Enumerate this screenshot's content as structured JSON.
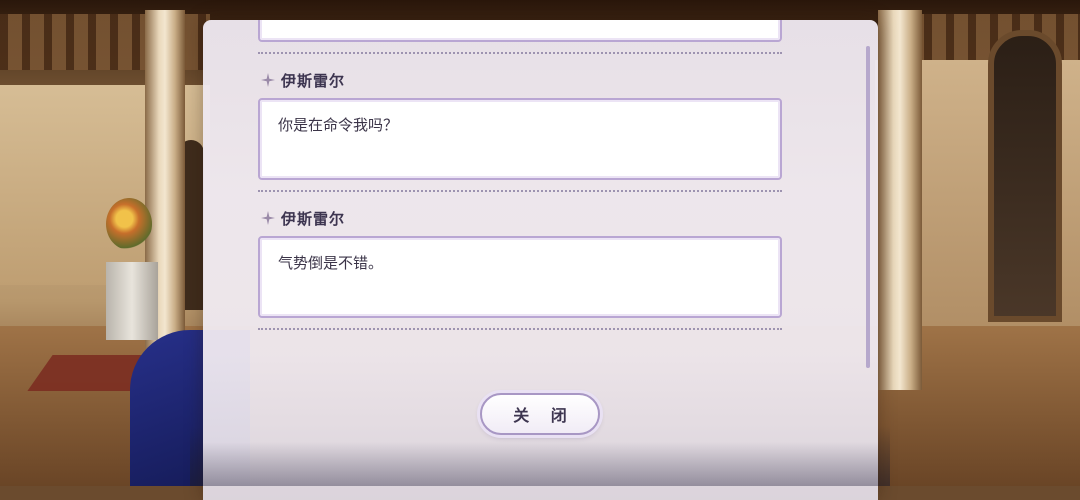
{
  "dialog_log": {
    "entries": [
      {
        "speaker": "",
        "text": ""
      },
      {
        "speaker": "伊斯雷尔",
        "text": "你是在命令我吗？"
      },
      {
        "speaker": "伊斯雷尔",
        "text": "气势倒是不错。"
      }
    ],
    "close_label": "关 闭"
  },
  "icons": {
    "speaker_marker": "sparkle-icon"
  },
  "colors": {
    "panel_bg": "#eee8f0",
    "bubble_border": "#b9a6d3",
    "text": "#3b3448",
    "name_text": "#3d3550"
  }
}
